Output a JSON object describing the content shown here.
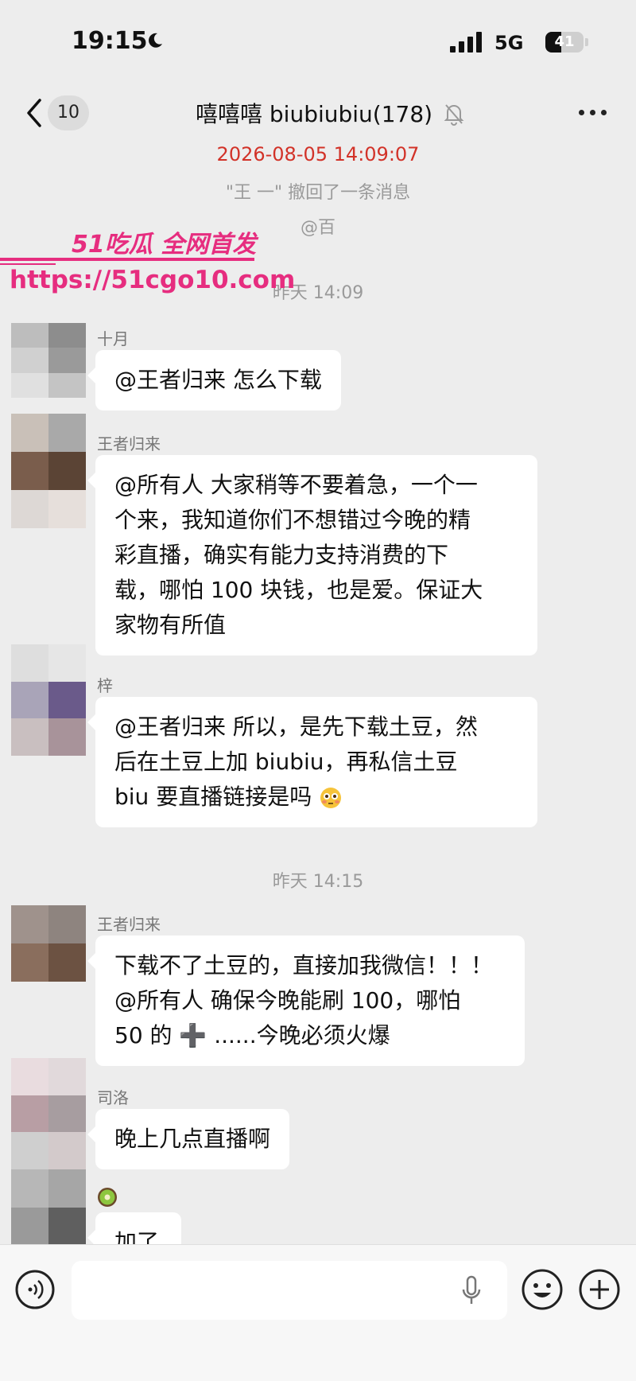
{
  "status_bar": {
    "time": "19:15",
    "network": "5G",
    "battery": "41",
    "battery_level": 0.41
  },
  "nav": {
    "back_count": "10",
    "title": "嘻嘻嘻 biubiubiu(178)"
  },
  "system": {
    "recall_time": "2026-08-05 14:09:07",
    "recall_text": "\"王 一\" 撤回了一条消息",
    "mention": "@百",
    "time1": "昨天 14:09",
    "time2": "昨天 14:15"
  },
  "watermark": {
    "line1": "51吃瓜 全网首发",
    "line2": "https://51cgo10.com"
  },
  "messages": [
    {
      "name": "十月",
      "lines": [
        "@王者归来 怎么下载"
      ]
    },
    {
      "name": "王者归来",
      "lines": [
        "@所有人 大家稍等不要着急，一个一",
        "个来，我知道你们不想错过今晚的精",
        "彩直播，确实有能力支持消费的下",
        "载，哪怕 100 块钱，也是爱。保证大",
        "家物有所值"
      ]
    },
    {
      "name": "梓",
      "lines": [
        "@王者归来 所以，是先下载土豆，然",
        "后在土豆上加 biubiu，再私信土豆",
        "biu 要直播链接是吗"
      ]
    },
    {
      "name": "王者归来",
      "lines": [
        "下载不了土豆的，直接加我微信！！！",
        "@所有人 确保今晚能刷 100，哪怕",
        "50 的 ➕ ......今晚必须火爆"
      ]
    },
    {
      "name": "司洛",
      "lines": [
        "晚上几点直播啊"
      ]
    },
    {
      "name": "",
      "lines": [
        "加了"
      ]
    }
  ],
  "icons": {
    "moon": "moon-icon",
    "signal": "signal-icon",
    "back": "chevron-left-icon",
    "mute": "bell-off-icon",
    "more": "more-icon",
    "voice": "voice-icon",
    "mic": "mic-icon",
    "emoji": "emoji-icon",
    "plus": "plus-icon",
    "kiwi": "kiwi-icon",
    "flushed": "flushed-face-icon"
  },
  "colors": {
    "accent_red": "#d23228",
    "watermark": "#e62d7f",
    "background": "#ededed"
  }
}
